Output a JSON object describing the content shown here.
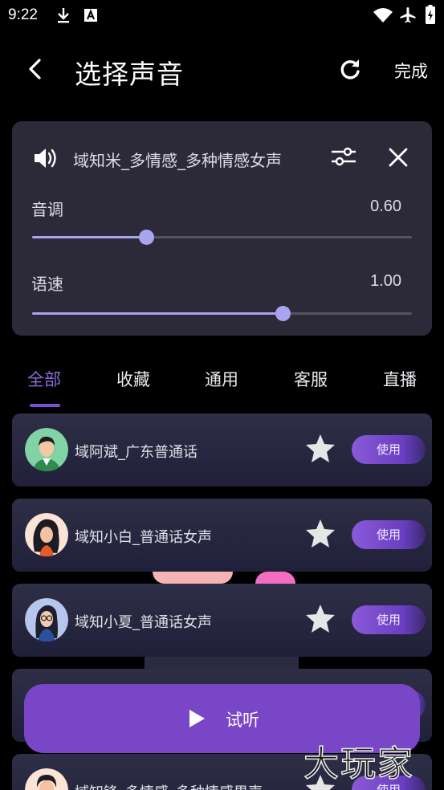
{
  "status_bar": {
    "time": "9:22"
  },
  "header": {
    "title": "选择声音",
    "done_label": "完成"
  },
  "current_voice": {
    "name": "域知米_多情感_多种情感女声",
    "params": [
      {
        "label": "音调",
        "value": "0.60",
        "level": 0.3
      },
      {
        "label": "语速",
        "value": "1.00",
        "level": 0.66
      }
    ]
  },
  "tabs": [
    "全部",
    "收藏",
    "通用",
    "客服",
    "直播"
  ],
  "active_tab": "全部",
  "voices": [
    {
      "name": "域阿斌_广东普通话",
      "use_label": "使用",
      "avatar": "man-avatar-icon"
    },
    {
      "name": "域知小白_普通话女声",
      "use_label": "使用",
      "avatar": "woman-curly-avatar-icon"
    },
    {
      "name": "域知小夏_普通话女声",
      "use_label": "使用",
      "avatar": "woman-glasses-avatar-icon"
    },
    {
      "name": "",
      "use_label": "",
      "avatar": ""
    },
    {
      "name": "域知锋_多情感_多种情感男声",
      "use_label": "使用",
      "avatar": "man-avatar-icon"
    }
  ],
  "listen_button": {
    "label": "试听"
  },
  "watermark": "大玩家",
  "colors": {
    "accent": "#7a46c8",
    "tab_active": "#8f6bd8",
    "slider": "#a9a4f0",
    "panel": "#2c2a38"
  }
}
